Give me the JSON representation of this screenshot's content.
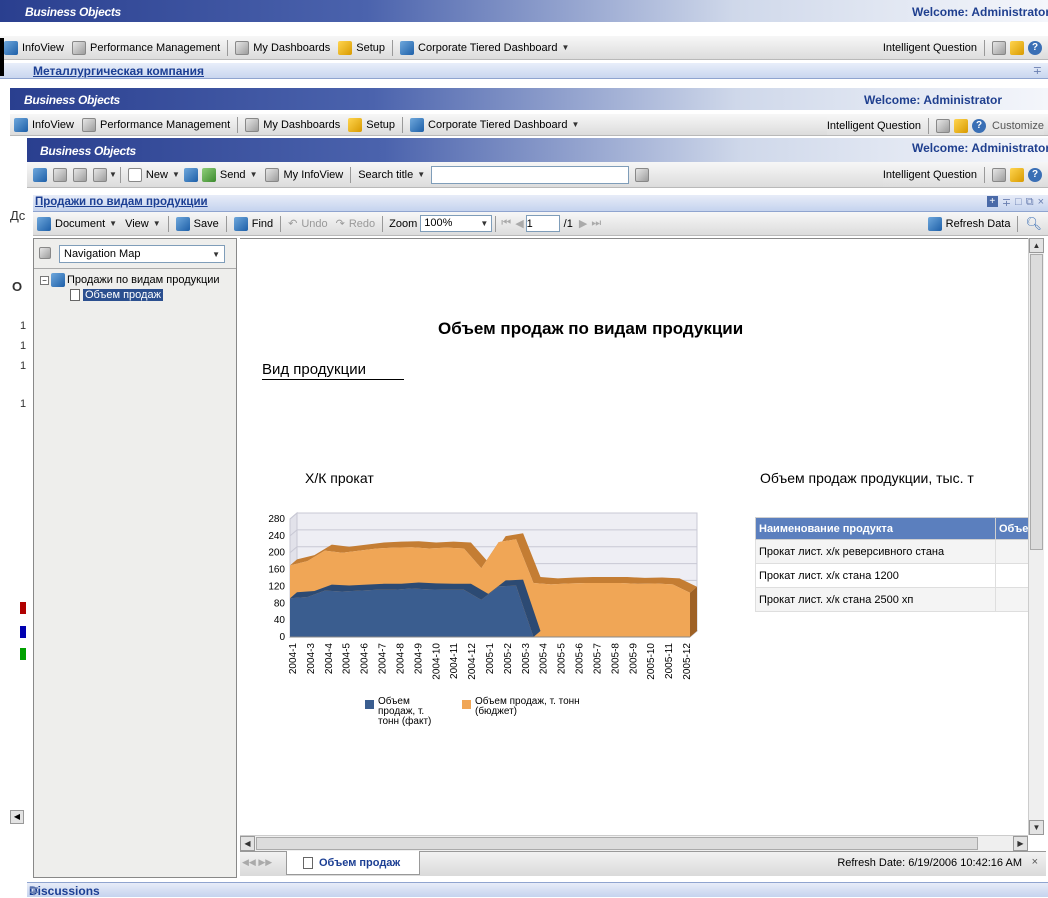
{
  "brand": "Business Objects",
  "welcome": "Welcome: Administrator",
  "nav": {
    "infoview": "InfoView",
    "perf": "Performance Management",
    "dashboards": "My Dashboards",
    "setup": "Setup",
    "corporate": "Corporate Tiered Dashboard",
    "iq": "Intelligent Question",
    "customize": "Customize"
  },
  "company_link": "Металлургическая компания",
  "bg_fragments": [
    "Дс",
    "О",
    "1",
    "1",
    "1",
    "1"
  ],
  "infoview_toolbar": {
    "new": "New",
    "send": "Send",
    "my_infoview": "My InfoView",
    "search_title": "Search title",
    "search_value": ""
  },
  "panel_title": "Продажи по видам продукции",
  "doc_toolbar": {
    "document": "Document",
    "view": "View",
    "save": "Save",
    "find": "Find",
    "undo": "Undo",
    "redo": "Redo",
    "zoom_label": "Zoom",
    "zoom_value": "100%",
    "page_value": "1",
    "page_total": "/1",
    "refresh": "Refresh Data"
  },
  "navmap": {
    "select": "Navigation Map",
    "root": "Продажи по видам продукции",
    "child": "Объем продаж"
  },
  "report": {
    "title": "Объем продаж по видам продукции",
    "section": "Вид продукции",
    "chart_title": "Х/К прокат",
    "table_title": "Объем продаж продукции, тыс. т",
    "table_headers": [
      "Наименование продукта",
      "Объе"
    ],
    "table_rows": [
      [
        "Прокат лист. х/к реверсивного стана",
        ""
      ],
      [
        "Прокат лист. х/к стана 1200",
        ""
      ],
      [
        "Прокат лист. х/к стана 2500 хп",
        ""
      ]
    ]
  },
  "bottom": {
    "tab": "Объем продаж",
    "refresh_date": "Refresh Date: 6/19/2006 10:42:16 AM"
  },
  "discussions": "Discussions",
  "chart_data": {
    "type": "area",
    "title": "",
    "xlabel": "",
    "ylabel": "",
    "ylim": [
      0,
      280
    ],
    "yticks": [
      0,
      40,
      80,
      120,
      160,
      200,
      240,
      280
    ],
    "stacked": true,
    "grid": true,
    "legend": "bottom",
    "categories": [
      "2004-1",
      "2004-2",
      "2004-3",
      "2004-4",
      "2004-5",
      "2004-6",
      "2004-7",
      "2004-8",
      "2004-9",
      "2004-10",
      "2004-11",
      "2004-12",
      "2005-1",
      "2005-2",
      "2005-3",
      "2005-4",
      "2005-5",
      "2005-6",
      "2005-7",
      "2005-8",
      "2005-9",
      "2005-10",
      "2005-11",
      "2005-12"
    ],
    "tick_labels": [
      "2004-1",
      "2004-3",
      "2004-4",
      "2004-5",
      "2004-6",
      "2004-7",
      "2004-8",
      "2004-9",
      "2004-10",
      "2004-11",
      "2004-12",
      "2005-1",
      "2005-2",
      "2005-3",
      "2005-4",
      "2005-5",
      "2005-6",
      "2005-7",
      "2005-8",
      "2005-9",
      "2005-10",
      "2005-11",
      "2005-12"
    ],
    "series": [
      {
        "name": "Объем продаж, т. тонн (факт)",
        "color": "#3a5d8f",
        "values": [
          92,
          95,
          110,
          108,
          110,
          112,
          112,
          115,
          113,
          112,
          112,
          88,
          120,
          122,
          0,
          0,
          0,
          0,
          0,
          0,
          0,
          0,
          0,
          0
        ]
      },
      {
        "name": "Объем продаж, т. тонн (бюджет)",
        "color": "#f0a656",
        "values": [
          78,
          85,
          95,
          92,
          95,
          98,
          100,
          98,
          97,
          100,
          98,
          75,
          105,
          110,
          128,
          125,
          127,
          128,
          128,
          128,
          126,
          127,
          125,
          105
        ]
      }
    ]
  }
}
